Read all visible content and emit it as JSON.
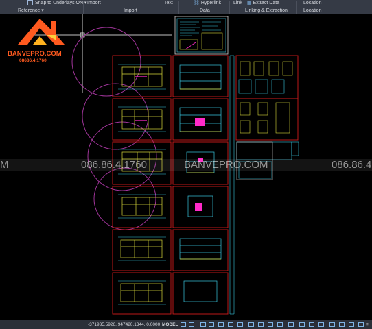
{
  "ribbon": {
    "snap_underlays": "Snap to Underlays ON",
    "import_btn": "Import",
    "reference_panel": "Reference",
    "import_panel": "Import",
    "text_btn": "Text",
    "hyperlink_btn": "Hyperlink",
    "data_panel": "Data",
    "link_btn": "Link",
    "extract_data_btn": "Extract Data",
    "linking_panel": "Linking & Extraction",
    "location_btn": "Location",
    "location_panel": "Location"
  },
  "logo": {
    "brand": "BANVEPRO.COM",
    "phone": "08686.4.1760",
    "colors": {
      "brand": "#ff5a1f",
      "phone": "#ff5a1f"
    }
  },
  "watermark": {
    "phone_center": "086.86.4.1760",
    "brand_center": "BANVEPRO.COM",
    "phone_right": "086.86.4",
    "left_fragment": "M"
  },
  "status": {
    "coordinates": "-371935.5926, 947420.1344, 0.0000",
    "model": "MODEL"
  },
  "colors": {
    "frame_red": "#d01c1c",
    "circle_magenta": "#a0359a",
    "cad_cyan": "#39c6e0",
    "cad_yellow": "#d8d83a",
    "cad_magenta": "#ff2ac8",
    "ribbon_bg": "#353a45"
  }
}
